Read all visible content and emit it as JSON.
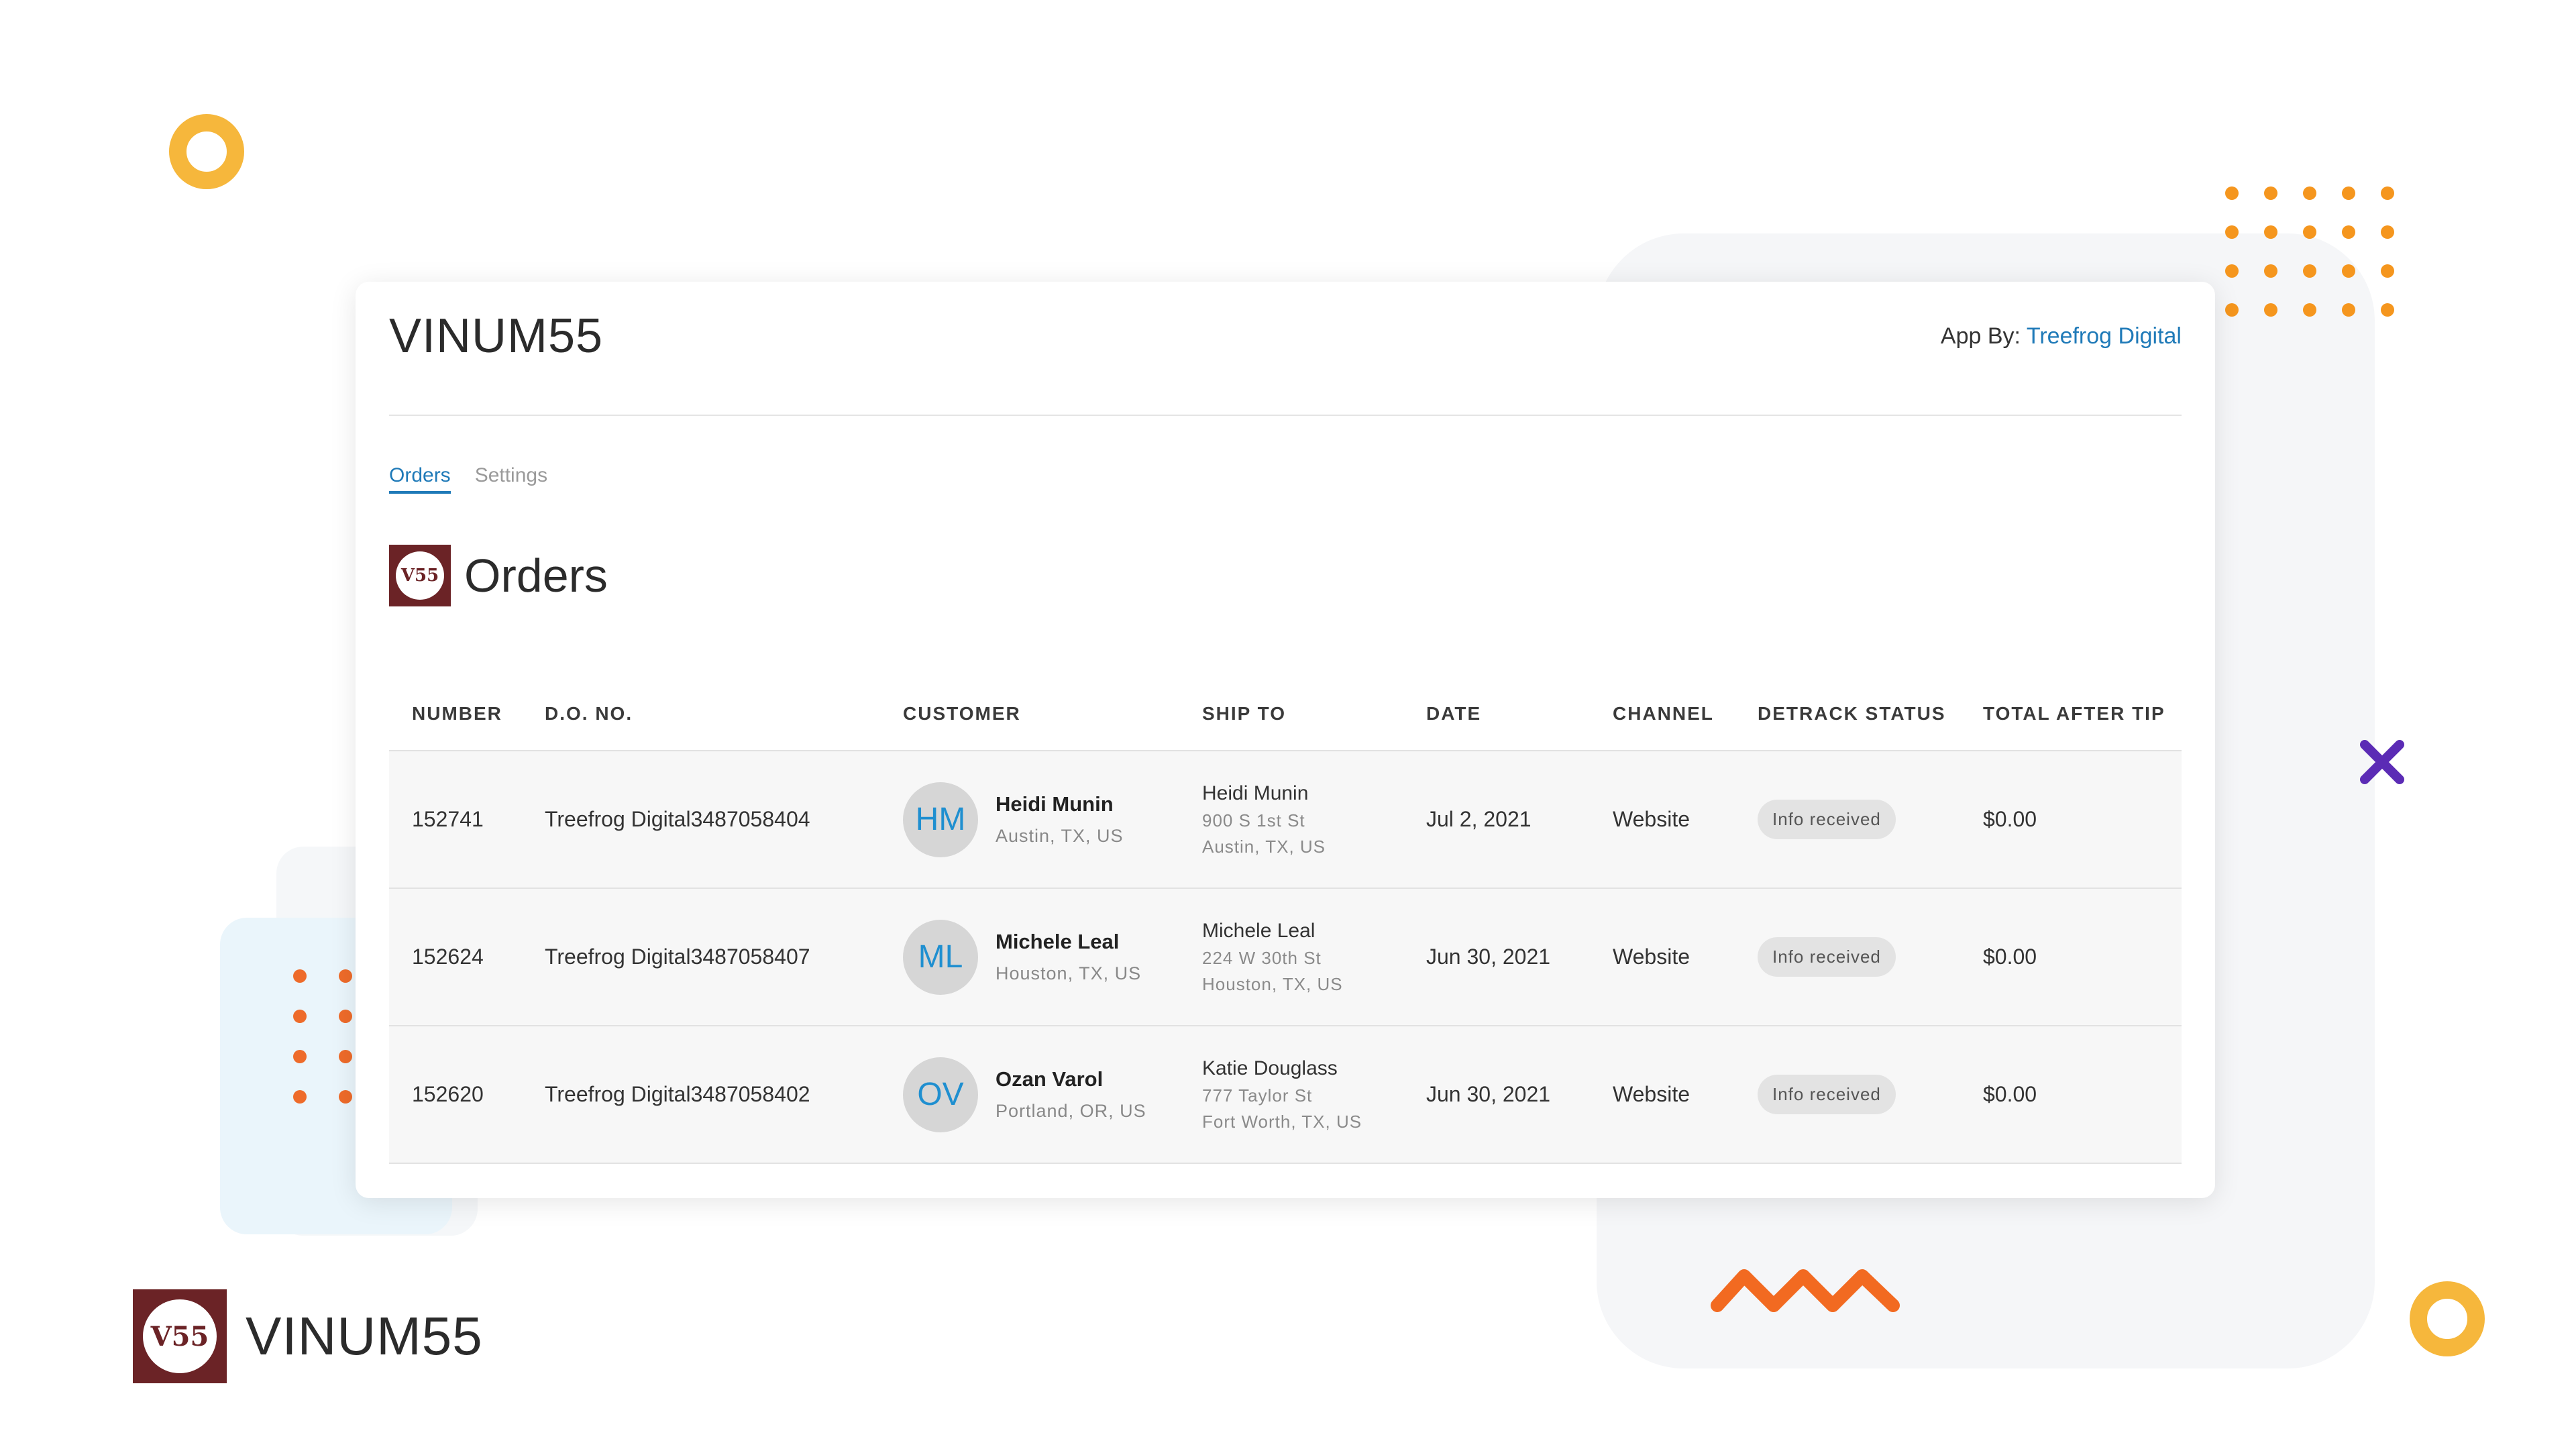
{
  "app": {
    "title": "VINUM55",
    "by_label": "App By:",
    "by_link": "Treefrog Digital"
  },
  "tabs": [
    {
      "label": "Orders",
      "active": true
    },
    {
      "label": "Settings",
      "active": false
    }
  ],
  "section": {
    "logo_text": "V55",
    "title": "Orders"
  },
  "table": {
    "headers": [
      "NUMBER",
      "D.O. NO.",
      "CUSTOMER",
      "SHIP TO",
      "DATE",
      "CHANNEL",
      "DETRACK STATUS",
      "TOTAL AFTER TIP"
    ],
    "rows": [
      {
        "number": "152741",
        "do_no": "Treefrog Digital3487058404",
        "initials": "HM",
        "customer": "Heidi Munin",
        "customer_loc": "Austin, TX, US",
        "ship_name": "Heidi Munin",
        "ship_street": "900 S 1st St",
        "ship_city": "Austin, TX, US",
        "date": "Jul 2, 2021",
        "channel": "Website",
        "status": "Info received",
        "total": "$0.00"
      },
      {
        "number": "152624",
        "do_no": "Treefrog Digital3487058407",
        "initials": "ML",
        "customer": "Michele Leal",
        "customer_loc": "Houston, TX, US",
        "ship_name": "Michele Leal",
        "ship_street": "224 W 30th St",
        "ship_city": "Houston, TX, US",
        "date": "Jun 30, 2021",
        "channel": "Website",
        "status": "Info received",
        "total": "$0.00"
      },
      {
        "number": "152620",
        "do_no": "Treefrog Digital3487058402",
        "initials": "OV",
        "customer": "Ozan Varol",
        "customer_loc": "Portland, OR, US",
        "ship_name": "Katie Douglass",
        "ship_street": "777 Taylor St",
        "ship_city": "Fort Worth, TX, US",
        "date": "Jun 30, 2021",
        "channel": "Website",
        "status": "Info received",
        "total": "$0.00"
      }
    ]
  },
  "brand": {
    "logo_text": "V55",
    "name": "VINUM55"
  },
  "colors": {
    "accent": "#1f7ab8",
    "brand": "#6b2326",
    "ring": "#f6b73c",
    "dots": "#f08a24",
    "cross": "#5b2bb5",
    "zigzag": "#f26a21"
  }
}
